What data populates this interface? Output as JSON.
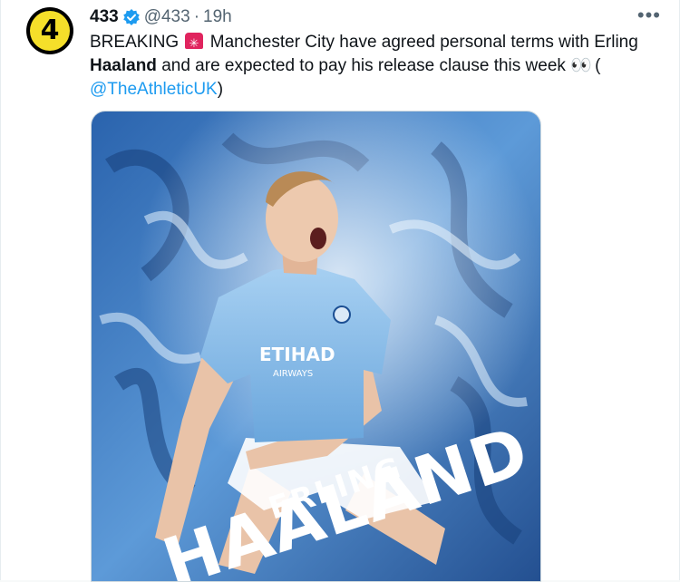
{
  "tweet": {
    "author_name": "433",
    "handle": "@433",
    "separator": "·",
    "time": "19h",
    "more_label": "•••",
    "avatar_text": "4",
    "text": {
      "part1": "BREAKING",
      "part2": " Manchester City have agreed personal terms with Erling ",
      "bold": "Haaland",
      "part3": " and are expected to pay his release clause this week ",
      "eyes": "👀",
      "paren_open": " (",
      "mention": "@TheAthleticUK",
      "paren_close": ")"
    },
    "image": {
      "shirt_sponsor_top": "ETIHAD",
      "shirt_sponsor_bottom": "AIRWAYS",
      "first_name": "ERLING",
      "last_name": "HAALAND"
    }
  },
  "colors": {
    "link": "#1d9bf0",
    "avatar_bg": "#f5df2a",
    "siren": "#e0245e",
    "poster_dark": "#1c4f93",
    "poster_light": "#7fb6e8"
  },
  "icons": [
    "verified-badge-icon",
    "siren-emoji-icon",
    "eyes-emoji-icon",
    "more-options-icon"
  ]
}
